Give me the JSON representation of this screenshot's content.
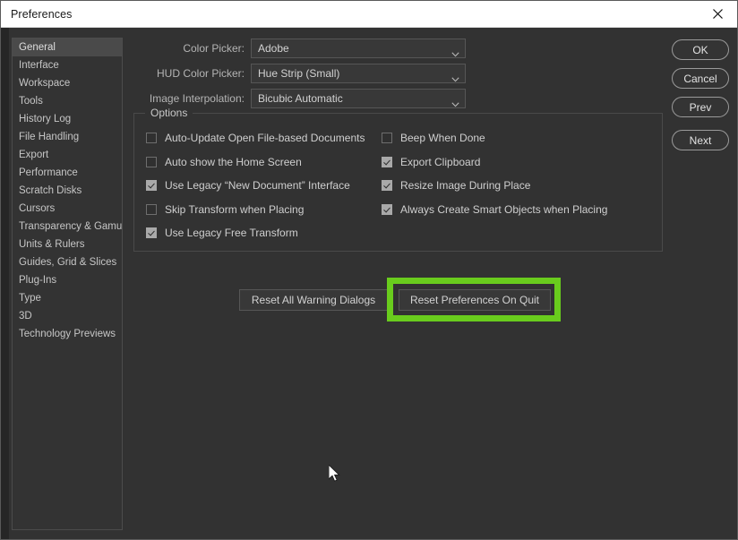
{
  "window": {
    "title": "Preferences",
    "close_icon": "close-icon"
  },
  "colors": {
    "highlight_green": "#69cc1d",
    "dialog_bg": "#323232",
    "titlebar_bg": "#ffffff",
    "selected_row": "#4a4a4a"
  },
  "sidebar": {
    "items": [
      {
        "label": "General",
        "selected": true
      },
      {
        "label": "Interface",
        "selected": false
      },
      {
        "label": "Workspace",
        "selected": false
      },
      {
        "label": "Tools",
        "selected": false
      },
      {
        "label": "History Log",
        "selected": false
      },
      {
        "label": "File Handling",
        "selected": false
      },
      {
        "label": "Export",
        "selected": false
      },
      {
        "label": "Performance",
        "selected": false
      },
      {
        "label": "Scratch Disks",
        "selected": false
      },
      {
        "label": "Cursors",
        "selected": false
      },
      {
        "label": "Transparency & Gamut",
        "selected": false
      },
      {
        "label": "Units & Rulers",
        "selected": false
      },
      {
        "label": "Guides, Grid & Slices",
        "selected": false
      },
      {
        "label": "Plug-Ins",
        "selected": false
      },
      {
        "label": "Type",
        "selected": false
      },
      {
        "label": "3D",
        "selected": false
      },
      {
        "label": "Technology Previews",
        "selected": false
      }
    ]
  },
  "fields": [
    {
      "label": "Color Picker:",
      "value": "Adobe",
      "icon": "chevron-down-icon"
    },
    {
      "label": "HUD Color Picker:",
      "value": "Hue Strip (Small)",
      "icon": "chevron-down-icon"
    },
    {
      "label": "Image Interpolation:",
      "value": "Bicubic Automatic",
      "icon": "chevron-down-icon"
    }
  ],
  "options": {
    "legend": "Options",
    "left_column": [
      {
        "label": "Auto-Update Open File-based Documents",
        "checked": false
      },
      {
        "label": "Auto show the Home Screen",
        "checked": false
      },
      {
        "label": "Use Legacy “New Document” Interface",
        "checked": true
      },
      {
        "label": "Skip Transform when Placing",
        "checked": false
      },
      {
        "label": "Use Legacy Free Transform",
        "checked": true
      }
    ],
    "right_column": [
      {
        "label": "Beep When Done",
        "checked": false
      },
      {
        "label": "Export Clipboard",
        "checked": true
      },
      {
        "label": "Resize Image During Place",
        "checked": true
      },
      {
        "label": "Always Create Smart Objects when Placing",
        "checked": true
      }
    ]
  },
  "reset_buttons": {
    "reset_all_warning_dialogs": "Reset All Warning Dialogs",
    "reset_preferences_on_quit": "Reset Preferences On Quit"
  },
  "action_buttons": [
    {
      "label": "OK"
    },
    {
      "label": "Cancel"
    },
    {
      "label": "Prev"
    },
    {
      "label": "Next"
    }
  ]
}
